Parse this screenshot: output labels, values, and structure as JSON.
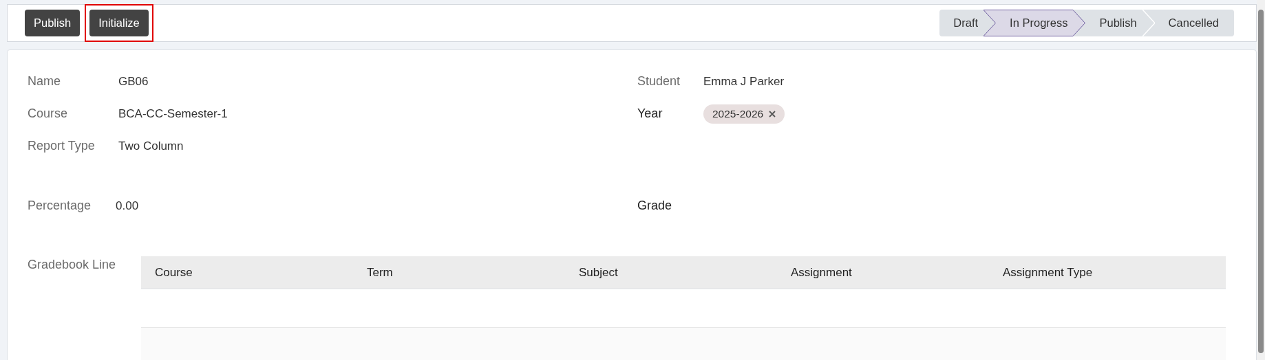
{
  "actions": [
    {
      "label": "Publish",
      "highlighted": false
    },
    {
      "label": "Initialize",
      "highlighted": true
    }
  ],
  "stages": [
    {
      "label": "Draft",
      "selected": false
    },
    {
      "label": "In Progress",
      "selected": true
    },
    {
      "label": "Publish",
      "selected": false
    },
    {
      "label": "Cancelled",
      "selected": false
    }
  ],
  "left_fields": [
    {
      "label": "Name",
      "value": "GB06",
      "kind": "text"
    },
    {
      "label": "Course",
      "value": "BCA-CC-Semester-1",
      "kind": "text"
    },
    {
      "label": "Report Type",
      "value": "Two Column",
      "kind": "text"
    },
    {
      "label": "Percentage",
      "value": "0.00",
      "kind": "text"
    }
  ],
  "right_fields": [
    {
      "label": "Student",
      "value": "Emma J Parker",
      "kind": "text"
    },
    {
      "label": "Year",
      "value": "2025-2026",
      "kind": "tag"
    },
    {
      "label": "Grade",
      "kind": "empty"
    }
  ],
  "gradebook": {
    "label": "Gradebook Line",
    "columns": [
      "Course",
      "Term",
      "Subject",
      "Assignment",
      "Assignment Type"
    ]
  }
}
